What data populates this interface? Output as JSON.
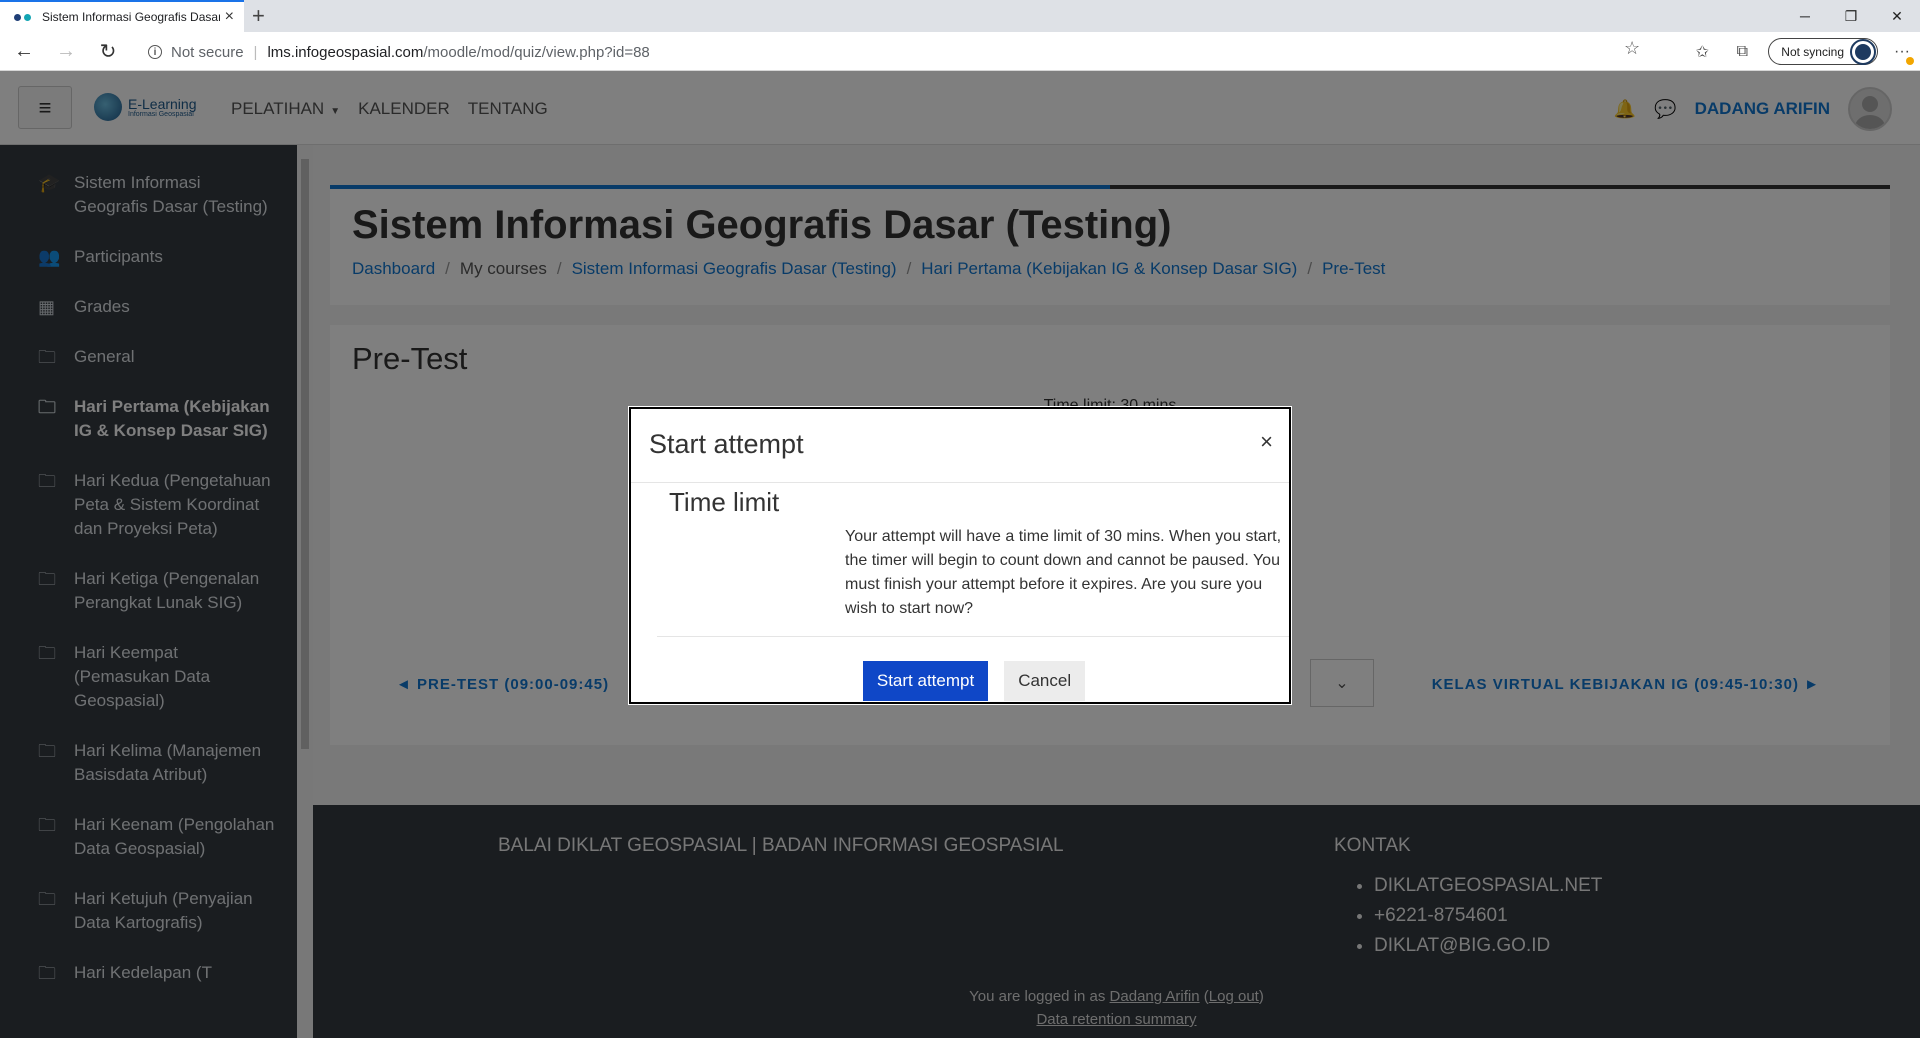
{
  "browser": {
    "tab_title": "Sistem Informasi Geografis Dasar",
    "tab_close": "×",
    "new_tab": "+",
    "security_label": "Not secure",
    "url_host": "lms.infogeospasial.com",
    "url_path": "/moodle/mod/quiz/view.php?id=88",
    "sync_label": "Not syncing"
  },
  "navbar": {
    "logo_title": "E-Learning",
    "logo_subtitle": "Informasi Geospasial",
    "menu": [
      "PELATIHAN",
      "KALENDER",
      "TENTANG"
    ],
    "username": "DADANG ARIFIN"
  },
  "sidebar": {
    "items": [
      {
        "label": "Sistem Informasi Geografis Dasar (Testing)",
        "icon": "graduation-cap-icon"
      },
      {
        "label": "Participants",
        "icon": "users-icon"
      },
      {
        "label": "Grades",
        "icon": "table-icon"
      },
      {
        "label": "General",
        "icon": "folder-icon"
      },
      {
        "label": "Hari Pertama (Kebijakan IG & Konsep Dasar SIG)",
        "icon": "folder-icon"
      },
      {
        "label": "Hari Kedua (Pengetahuan Peta & Sistem Koordinat dan Proyeksi Peta)",
        "icon": "folder-icon"
      },
      {
        "label": "Hari Ketiga (Pengenalan Perangkat Lunak SIG)",
        "icon": "folder-icon"
      },
      {
        "label": "Hari Keempat (Pemasukan Data Geospasial)",
        "icon": "folder-icon"
      },
      {
        "label": "Hari Kelima (Manajemen Basisdata Atribut)",
        "icon": "folder-icon"
      },
      {
        "label": "Hari Keenam (Pengolahan Data Geospasial)",
        "icon": "folder-icon"
      },
      {
        "label": "Hari Ketujuh (Penyajian Data Kartografis)",
        "icon": "folder-icon"
      },
      {
        "label": "Hari Kedelapan (T",
        "icon": "folder-icon"
      }
    ]
  },
  "header": {
    "course_title": "Sistem Informasi Geografis Dasar (Testing)",
    "breadcrumb": [
      "Dashboard",
      "My courses",
      "Sistem Informasi Geografis Dasar (Testing)",
      "Hari Pertama (Kebijakan IG & Konsep Dasar SIG)",
      "Pre-Test"
    ],
    "breadcrumb_sep": "/"
  },
  "main": {
    "heading": "Pre-Test",
    "time_limit_label": "Time limit: 30 mins",
    "prev_link": "◄ PRE-TEST (09:00-09:45)",
    "next_link": "KELAS VIRTUAL KEBIJAKAN IG (09:45-10:30) ►"
  },
  "footer": {
    "brand": "BALAI DIKLAT GEOSPASIAL | BADAN INFORMASI GEOSPASIAL",
    "contact_title": "KONTAK",
    "contacts": [
      "DIKLATGEOSPASIAL.NET",
      "+6221-8754601",
      "DIKLAT@BIG.GO.ID"
    ],
    "logged_in_prefix": "You are logged in as ",
    "logged_in_user": "Dadang Arifin",
    "logout": "Log out",
    "retention": "Data retention summary"
  },
  "modal": {
    "title": "Start attempt",
    "close": "×",
    "section_heading": "Time limit",
    "message": "Your attempt will have a time limit of 30 mins. When you start, the timer will begin to count down and cannot be paused. You must finish your attempt before it expires. Are you sure you wish to start now?",
    "start_button": "Start attempt",
    "cancel_button": "Cancel"
  },
  "colors": {
    "accent": "#1177d1",
    "primary_button": "#0f47c7",
    "drawer_bg": "#343a40"
  }
}
